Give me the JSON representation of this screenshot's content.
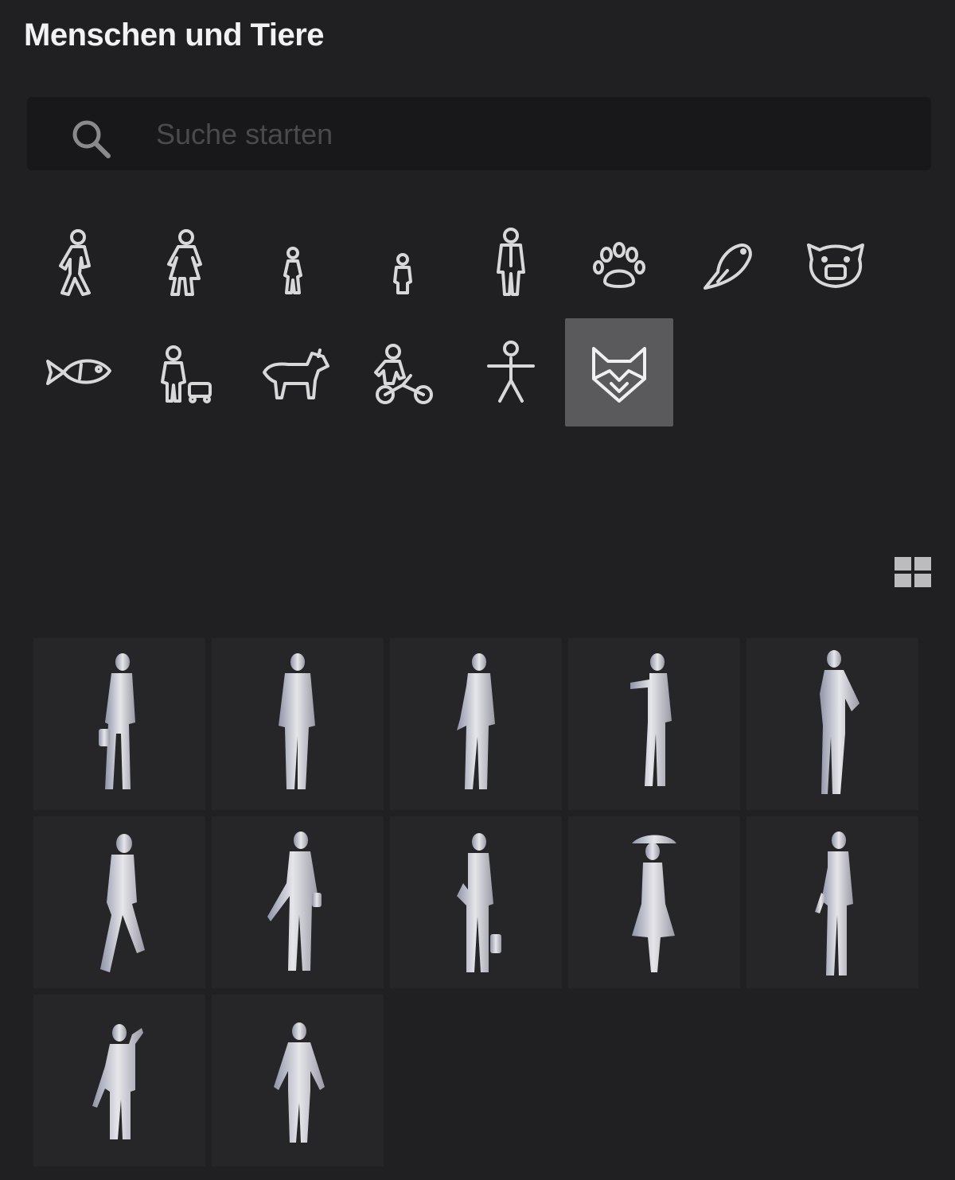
{
  "panel": {
    "title": "Menschen und Tiere"
  },
  "search": {
    "placeholder": "Suche starten",
    "value": "",
    "icon": "search-icon"
  },
  "categories": [
    {
      "icon": "walking-man-icon",
      "selected": false
    },
    {
      "icon": "woman-icon",
      "selected": false
    },
    {
      "icon": "child-icon",
      "selected": false
    },
    {
      "icon": "toddler-icon",
      "selected": false
    },
    {
      "icon": "businessman-icon",
      "selected": false
    },
    {
      "icon": "paw-icon",
      "selected": false
    },
    {
      "icon": "bird-icon",
      "selected": false
    },
    {
      "icon": "pig-icon",
      "selected": false
    },
    {
      "icon": "fish-icon",
      "selected": false
    },
    {
      "icon": "person-with-stroller-icon",
      "selected": false
    },
    {
      "icon": "dog-icon",
      "selected": false
    },
    {
      "icon": "person-on-bicycle-icon",
      "selected": false
    },
    {
      "icon": "stick-figure-icon",
      "selected": false
    },
    {
      "icon": "fox-icon",
      "selected": true
    }
  ],
  "view_toggle": {
    "icon": "grid-view-icon"
  },
  "results": [
    {
      "icon": "person-model-with-bag"
    },
    {
      "icon": "person-model-standing"
    },
    {
      "icon": "person-model-standing"
    },
    {
      "icon": "person-model-pointing"
    },
    {
      "icon": "person-model-hand-on-hip"
    },
    {
      "icon": "person-model-walking"
    },
    {
      "icon": "person-model-with-bag"
    },
    {
      "icon": "person-model-with-bag"
    },
    {
      "icon": "person-model-with-umbrella"
    },
    {
      "icon": "person-model-standing"
    },
    {
      "icon": "person-model-waving"
    },
    {
      "icon": "person-model-child"
    }
  ],
  "colors": {
    "background": "#202023",
    "search_bg": "#18181a",
    "tile_bg": "#262629",
    "selected_bg": "#5a5a5c",
    "icon_stroke": "#d8d8d8"
  }
}
